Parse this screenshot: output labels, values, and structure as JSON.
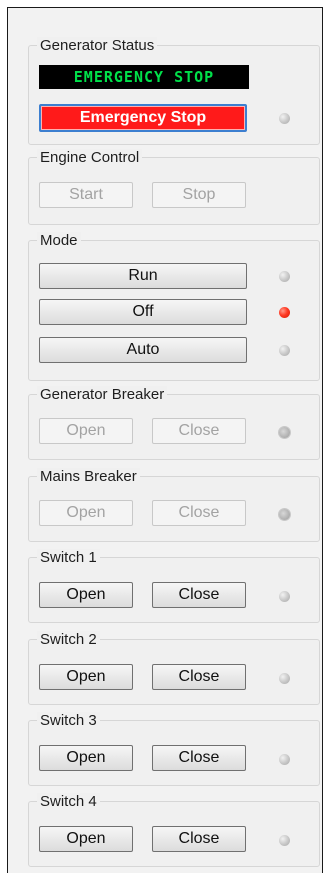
{
  "generator_status": {
    "title": "Generator Status",
    "display_text": "EMERGENCY STOP",
    "estop_label": "Emergency Stop"
  },
  "engine_control": {
    "title": "Engine Control",
    "start_label": "Start",
    "stop_label": "Stop"
  },
  "mode": {
    "title": "Mode",
    "run_label": "Run",
    "off_label": "Off",
    "auto_label": "Auto",
    "active": "Off"
  },
  "generator_breaker": {
    "title": "Generator Breaker",
    "open_label": "Open",
    "close_label": "Close"
  },
  "mains_breaker": {
    "title": "Mains Breaker",
    "open_label": "Open",
    "close_label": "Close"
  },
  "switches": [
    {
      "title": "Switch 1",
      "open_label": "Open",
      "close_label": "Close"
    },
    {
      "title": "Switch 2",
      "open_label": "Open",
      "close_label": "Close"
    },
    {
      "title": "Switch 3",
      "open_label": "Open",
      "close_label": "Close"
    },
    {
      "title": "Switch 4",
      "open_label": "Open",
      "close_label": "Close"
    }
  ],
  "colors": {
    "lcd_text": "#00e04a",
    "estop_bg": "#ff1a1a",
    "led_on": "#ff3b25"
  }
}
